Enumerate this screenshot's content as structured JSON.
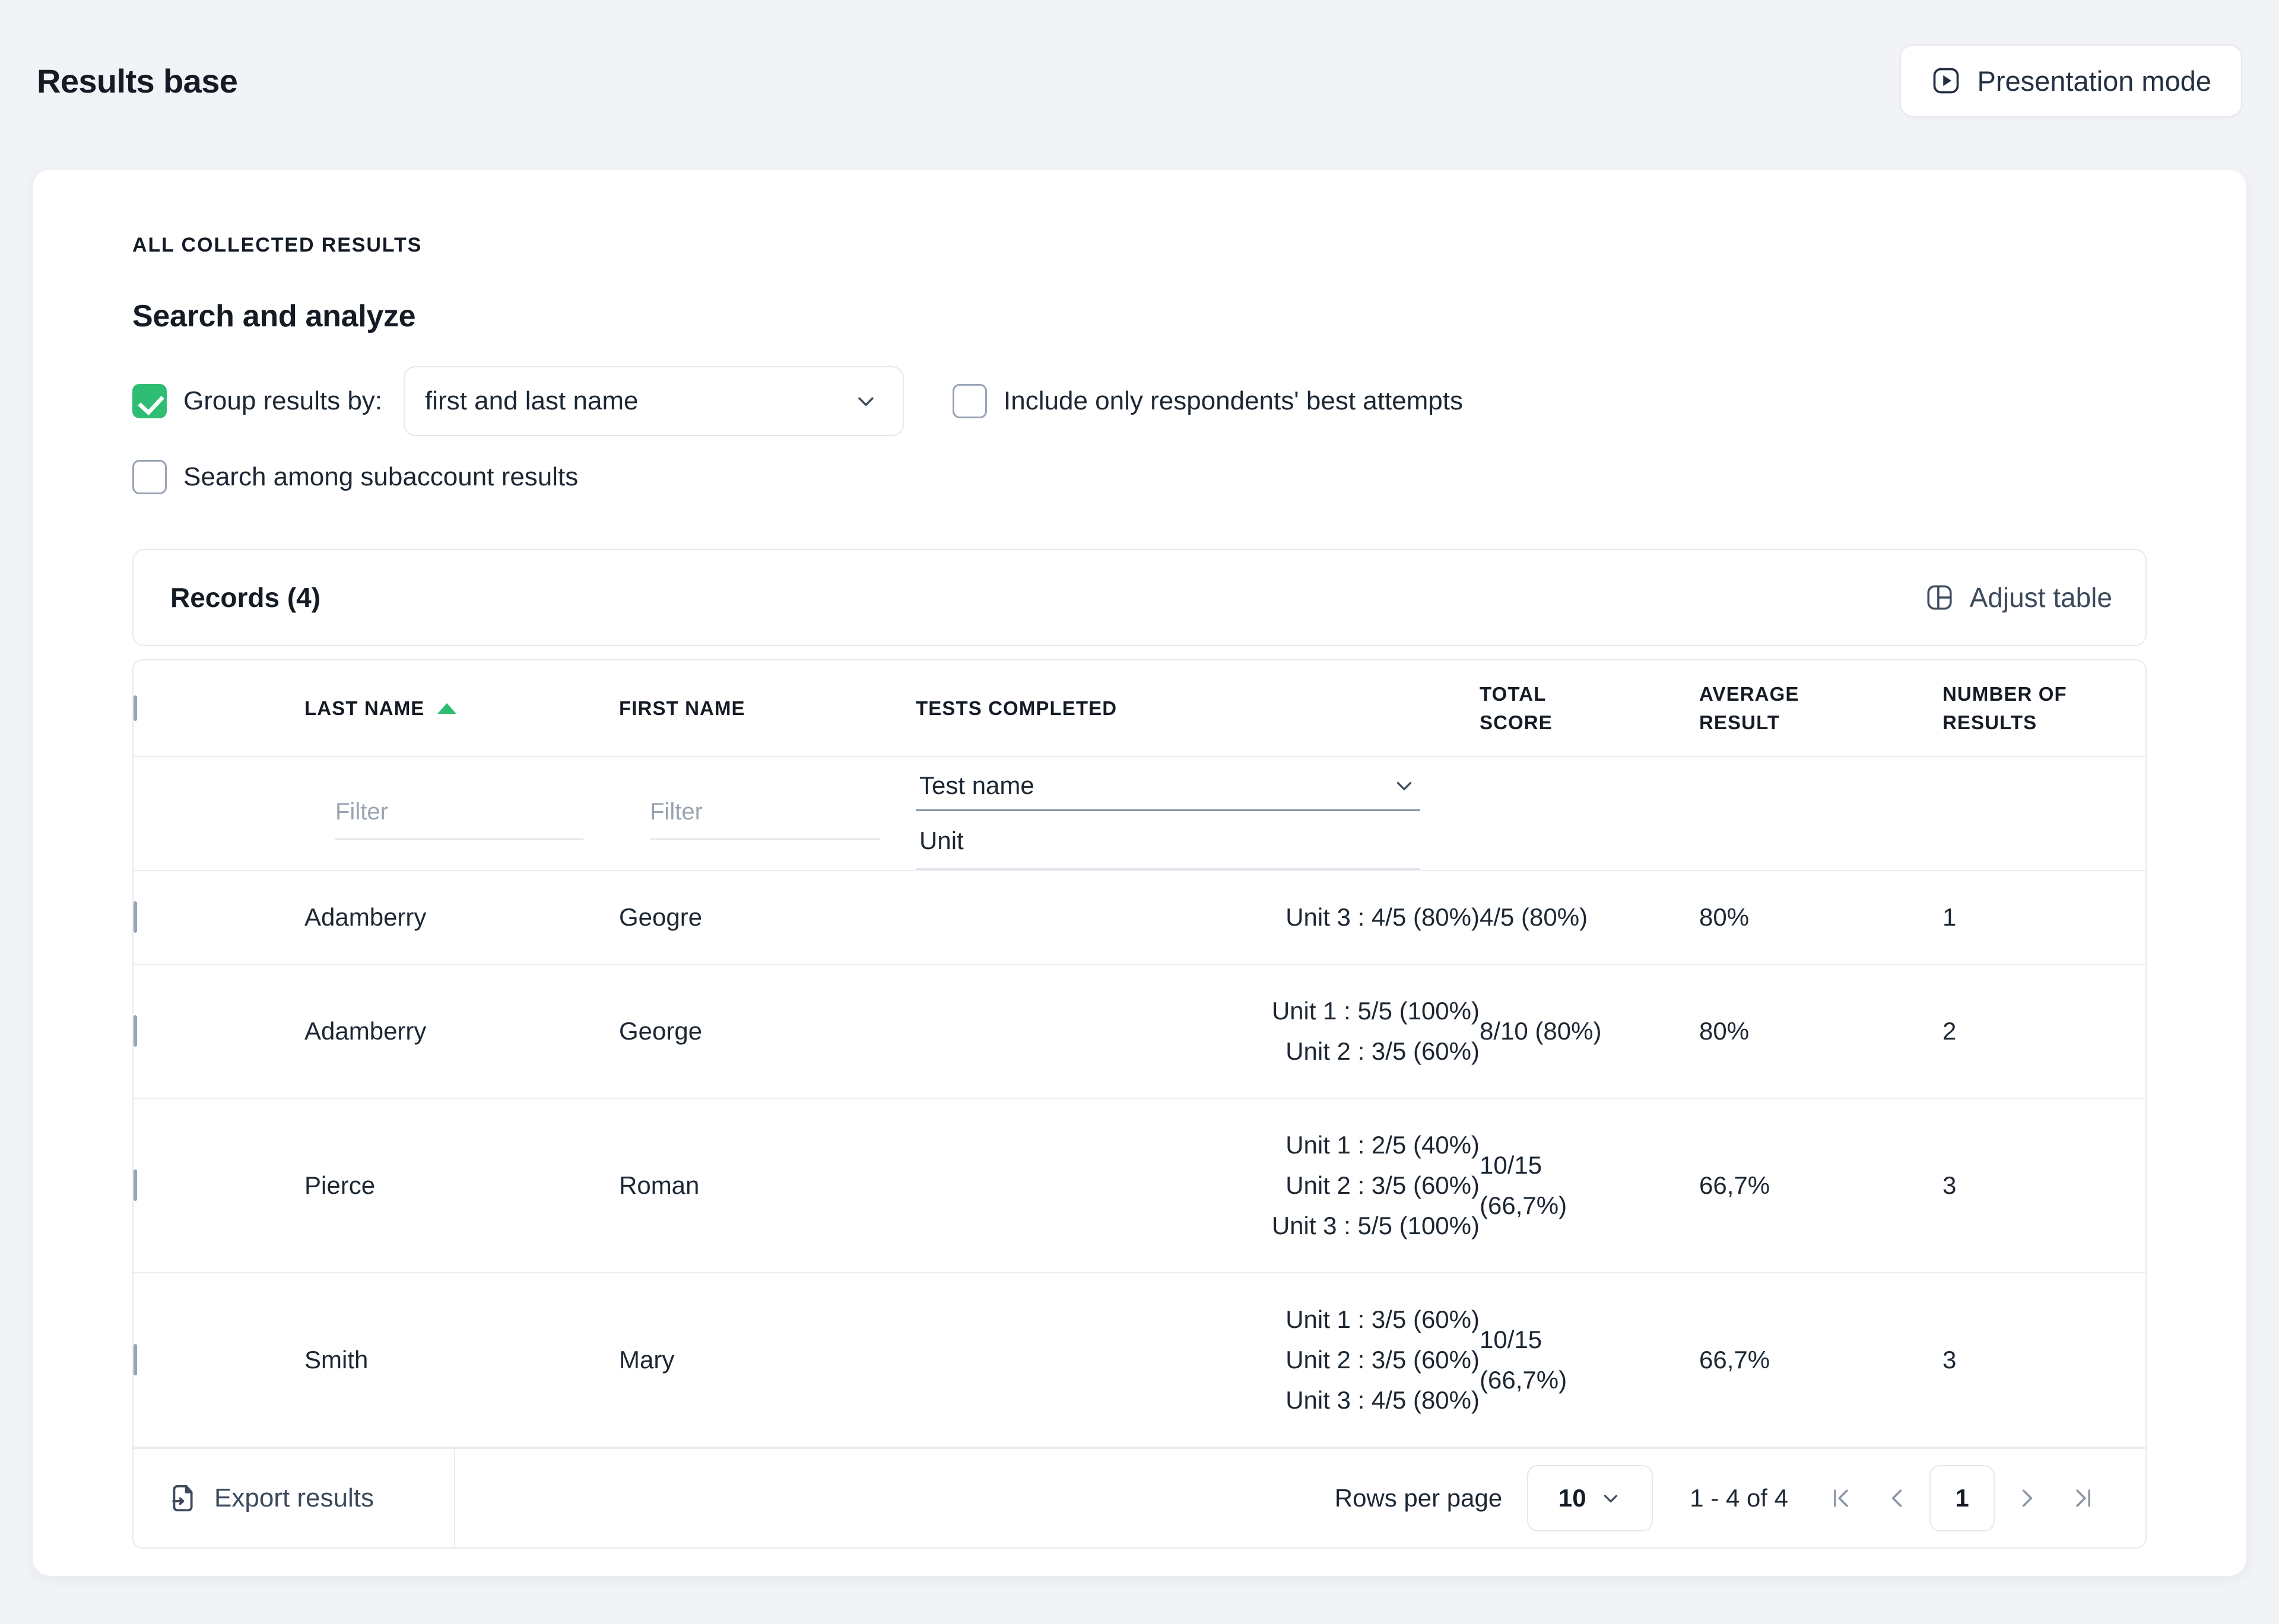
{
  "header": {
    "title": "Results base",
    "presentation_button": "Presentation mode",
    "presentation_icon": "play-in-square-icon"
  },
  "panel": {
    "eyebrow": "ALL COLLECTED RESULTS",
    "section_title": "Search and analyze",
    "controls": {
      "group_results_label": "Group results by:",
      "group_results_checked": true,
      "group_by_value": "first and last name",
      "best_attempts_label": "Include only respondents' best attempts",
      "best_attempts_checked": false,
      "subaccount_label": "Search among subaccount results",
      "subaccount_checked": false
    },
    "records_bar": {
      "count_label": "Records (4)",
      "adjust_table_label": "Adjust table",
      "adjust_table_icon": "layout-columns-icon"
    }
  },
  "table": {
    "columns": [
      {
        "key": "checkbox",
        "label": ""
      },
      {
        "key": "last_name",
        "label": "LAST NAME",
        "sorted": "asc"
      },
      {
        "key": "first_name",
        "label": "FIRST NAME"
      },
      {
        "key": "tests_completed",
        "label": "TESTS COMPLETED"
      },
      {
        "key": "total_score",
        "label": "TOTAL\nSCORE"
      },
      {
        "key": "average_result",
        "label": "AVERAGE\nRESULT"
      },
      {
        "key": "number_of_results",
        "label": "NUMBER OF\nRESULTS"
      }
    ],
    "header_labels": {
      "last_name": "LAST NAME",
      "first_name": "FIRST NAME",
      "tests_completed": "TESTS COMPLETED",
      "total_score_l1": "TOTAL",
      "total_score_l2": "SCORE",
      "average_result_l1": "AVERAGE",
      "average_result_l2": "RESULT",
      "number_of_results_l1": "NUMBER OF",
      "number_of_results_l2": "RESULTS"
    },
    "filters": {
      "last_name_placeholder": "Filter",
      "last_name_value": "",
      "first_name_placeholder": "Filter",
      "first_name_value": "",
      "test_name_selected": "Test name",
      "test_name_unit": "Unit"
    },
    "rows": [
      {
        "last_name": "Adamberry",
        "first_name": "Geogre",
        "tests_completed": "Unit 3 : 4/5 (80%)",
        "total_score": "4/5 (80%)",
        "average_result": "80%",
        "number_of_results": "1"
      },
      {
        "last_name": "Adamberry",
        "first_name": "George",
        "tests_completed": "Unit 1 : 5/5 (100%)\nUnit 2 : 3/5 (60%)",
        "total_score": "8/10 (80%)",
        "average_result": "80%",
        "number_of_results": "2"
      },
      {
        "last_name": "Pierce",
        "first_name": "Roman",
        "tests_completed": "Unit 1 : 2/5 (40%)\nUnit 2 : 3/5 (60%)\nUnit 3 : 5/5 (100%)",
        "total_score": "10/15\n(66,7%)",
        "average_result": "66,7%",
        "number_of_results": "3"
      },
      {
        "last_name": "Smith",
        "first_name": "Mary",
        "tests_completed": "Unit 1 : 3/5 (60%)\nUnit 2 : 3/5 (60%)\nUnit 3 : 4/5 (80%)",
        "total_score": "10/15\n(66,7%)",
        "average_result": "66,7%",
        "number_of_results": "3"
      }
    ],
    "footer": {
      "export_label": "Export results",
      "export_icon": "file-export-icon",
      "rows_per_page_label": "Rows per page",
      "rows_per_page_value": "10",
      "range_label": "1 - 4 of 4",
      "current_page": "1",
      "first_page_icon": "first-page-icon",
      "prev_page_icon": "prev-page-icon",
      "next_page_icon": "next-page-icon",
      "last_page_icon": "last-page-icon"
    }
  },
  "colors": {
    "accent_green": "#2ebd72",
    "page_bg": "#f1f3f7",
    "card_bg": "#ffffff",
    "text_primary": "#141b24",
    "text_secondary": "#3c4a5c",
    "border": "#e7eaf0"
  }
}
